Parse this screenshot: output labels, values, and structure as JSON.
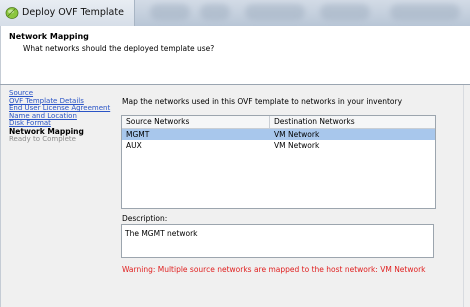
{
  "window": {
    "title": "Deploy OVF Template"
  },
  "header": {
    "title": "Network Mapping",
    "subtitle": "What networks should the deployed template use?"
  },
  "steps": [
    {
      "label": "Source",
      "state": "link"
    },
    {
      "label": "OVF Template Details",
      "state": "link"
    },
    {
      "label": "End User License Agreement",
      "state": "link"
    },
    {
      "label": "Name and Location",
      "state": "link"
    },
    {
      "label": "Disk Format",
      "state": "link"
    },
    {
      "label": "Network Mapping",
      "state": "current"
    },
    {
      "label": "Ready to Complete",
      "state": "future"
    }
  ],
  "main": {
    "instruction": "Map the networks used in this OVF template to networks in your inventory",
    "table": {
      "columns": [
        "Source Networks",
        "Destination Networks"
      ],
      "rows": [
        {
          "source": "MGMT",
          "destination": "VM Network",
          "selected": true
        },
        {
          "source": "AUX",
          "destination": "VM Network",
          "selected": false
        }
      ]
    },
    "description_label": "Description:",
    "description_text": "The MGMT network",
    "warning": "Warning: Multiple source networks are mapped to the host network: VM Network"
  },
  "colors": {
    "link": "#2a54c6",
    "warning": "#e02020",
    "selection": "#a8c7ec",
    "app_icon": "#8cc63f"
  },
  "icons": {
    "app": "ovf-deploy-icon"
  }
}
